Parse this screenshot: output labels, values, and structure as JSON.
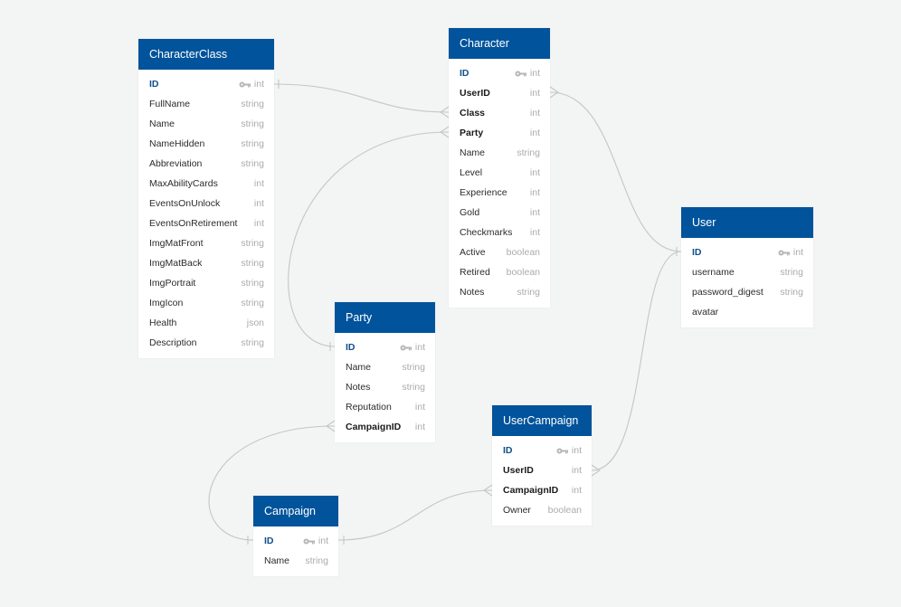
{
  "colors": {
    "header_bg": "#01539b",
    "background": "#f3f4f4",
    "pk_text": "#0f4f8a",
    "type_text": "#a9abad",
    "connector": "#c4c6c7"
  },
  "tables": {
    "characterclass": {
      "title": "CharacterClass",
      "fields": [
        {
          "name": "ID",
          "type": "int",
          "role": "pk"
        },
        {
          "name": "FullName",
          "type": "string",
          "role": ""
        },
        {
          "name": "Name",
          "type": "string",
          "role": ""
        },
        {
          "name": "NameHidden",
          "type": "string",
          "role": ""
        },
        {
          "name": "Abbreviation",
          "type": "string",
          "role": ""
        },
        {
          "name": "MaxAbilityCards",
          "type": "int",
          "role": ""
        },
        {
          "name": "EventsOnUnlock",
          "type": "int",
          "role": ""
        },
        {
          "name": "EventsOnRetirement",
          "type": "int",
          "role": ""
        },
        {
          "name": "ImgMatFront",
          "type": "string",
          "role": ""
        },
        {
          "name": "ImgMatBack",
          "type": "string",
          "role": ""
        },
        {
          "name": "ImgPortrait",
          "type": "string",
          "role": ""
        },
        {
          "name": "ImgIcon",
          "type": "string",
          "role": ""
        },
        {
          "name": "Health",
          "type": "json",
          "role": ""
        },
        {
          "name": "Description",
          "type": "string",
          "role": ""
        }
      ]
    },
    "character": {
      "title": "Character",
      "fields": [
        {
          "name": "ID",
          "type": "int",
          "role": "pk"
        },
        {
          "name": "UserID",
          "type": "int",
          "role": "fk"
        },
        {
          "name": "Class",
          "type": "int",
          "role": "fk"
        },
        {
          "name": "Party",
          "type": "int",
          "role": "fk"
        },
        {
          "name": "Name",
          "type": "string",
          "role": ""
        },
        {
          "name": "Level",
          "type": "int",
          "role": ""
        },
        {
          "name": "Experience",
          "type": "int",
          "role": ""
        },
        {
          "name": "Gold",
          "type": "int",
          "role": ""
        },
        {
          "name": "Checkmarks",
          "type": "int",
          "role": ""
        },
        {
          "name": "Active",
          "type": "boolean",
          "role": ""
        },
        {
          "name": "Retired",
          "type": "boolean",
          "role": ""
        },
        {
          "name": "Notes",
          "type": "string",
          "role": ""
        }
      ]
    },
    "user": {
      "title": "User",
      "fields": [
        {
          "name": "ID",
          "type": "int",
          "role": "pk"
        },
        {
          "name": "username",
          "type": "string",
          "role": ""
        },
        {
          "name": "password_digest",
          "type": "string",
          "role": ""
        },
        {
          "name": "avatar",
          "type": "",
          "role": ""
        }
      ]
    },
    "party": {
      "title": "Party",
      "fields": [
        {
          "name": "ID",
          "type": "int",
          "role": "pk"
        },
        {
          "name": "Name",
          "type": "string",
          "role": ""
        },
        {
          "name": "Notes",
          "type": "string",
          "role": ""
        },
        {
          "name": "Reputation",
          "type": "int",
          "role": ""
        },
        {
          "name": "CampaignID",
          "type": "int",
          "role": "fk"
        }
      ]
    },
    "usercampaign": {
      "title": "UserCampaign",
      "fields": [
        {
          "name": "ID",
          "type": "int",
          "role": "pk"
        },
        {
          "name": "UserID",
          "type": "int",
          "role": "fk"
        },
        {
          "name": "CampaignID",
          "type": "int",
          "role": "fk"
        },
        {
          "name": "Owner",
          "type": "boolean",
          "role": ""
        }
      ]
    },
    "campaign": {
      "title": "Campaign",
      "fields": [
        {
          "name": "ID",
          "type": "int",
          "role": "pk"
        },
        {
          "name": "Name",
          "type": "string",
          "role": ""
        }
      ]
    }
  },
  "relationships": [
    {
      "from": "CharacterClass.ID",
      "to": "Character.Class",
      "cardinality": "one-to-many"
    },
    {
      "from": "Party.ID",
      "to": "Character.Party",
      "cardinality": "one-to-many"
    },
    {
      "from": "User.ID",
      "to": "Character.UserID",
      "cardinality": "one-to-many"
    },
    {
      "from": "User.ID",
      "to": "UserCampaign.UserID",
      "cardinality": "one-to-many"
    },
    {
      "from": "Campaign.ID",
      "to": "Party.CampaignID",
      "cardinality": "one-to-many"
    },
    {
      "from": "Campaign.ID",
      "to": "UserCampaign.CampaignID",
      "cardinality": "one-to-many"
    }
  ]
}
